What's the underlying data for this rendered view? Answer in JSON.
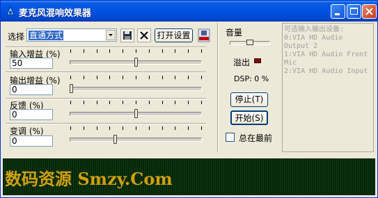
{
  "window": {
    "title": "麦克风混响效果器",
    "accent": "#0054e3"
  },
  "toolbar": {
    "select_label": "选择",
    "preset_value": "直通方式",
    "open_settings_label": "打开设置"
  },
  "controls": [
    {
      "label": "输入增益 (%)",
      "value": "50",
      "level": 50
    },
    {
      "label": "输出增益 (%)",
      "value": "0",
      "level": 0
    },
    {
      "label": "反馈 (%)",
      "value": "0",
      "level": 50
    },
    {
      "label": "变调 (%)",
      "value": "0",
      "level": 34
    }
  ],
  "volume": {
    "label": "音量",
    "overflow_label": "溢出",
    "dsp_label": "DSP: 0 %"
  },
  "buttons": {
    "stop": "停止(T)",
    "start": "开始(S)"
  },
  "always_on_top_label": "总在最前",
  "devices": {
    "header": "可选输入输出设备:",
    "lines": [
      "0:VIA HD Audio",
      "Output 2",
      "1:VIA HD Audio Front",
      "Mic",
      "2:VIA HD Audio Input"
    ]
  },
  "led_banner": "数码资源 Smzy.Com"
}
